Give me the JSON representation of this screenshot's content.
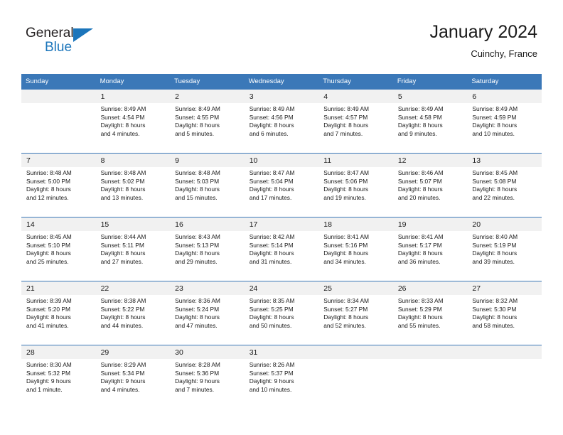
{
  "logo": {
    "word_one": "General",
    "word_two": "Blue",
    "triangle_icon": "triangle-icon",
    "brand_color": "#1b75bb"
  },
  "header": {
    "title": "January 2024",
    "location": "Cuinchy, France"
  },
  "calendar": {
    "header_bg": "#3b78b8",
    "daynum_bg": "#f1f1f1",
    "weekday_headers": [
      "Sunday",
      "Monday",
      "Tuesday",
      "Wednesday",
      "Thursday",
      "Friday",
      "Saturday"
    ],
    "weeks": [
      [
        {
          "day": "",
          "sunrise": "",
          "sunset": "",
          "daylight_line1": "",
          "daylight_line2": ""
        },
        {
          "day": "1",
          "sunrise": "Sunrise: 8:49 AM",
          "sunset": "Sunset: 4:54 PM",
          "daylight_line1": "Daylight: 8 hours",
          "daylight_line2": "and 4 minutes."
        },
        {
          "day": "2",
          "sunrise": "Sunrise: 8:49 AM",
          "sunset": "Sunset: 4:55 PM",
          "daylight_line1": "Daylight: 8 hours",
          "daylight_line2": "and 5 minutes."
        },
        {
          "day": "3",
          "sunrise": "Sunrise: 8:49 AM",
          "sunset": "Sunset: 4:56 PM",
          "daylight_line1": "Daylight: 8 hours",
          "daylight_line2": "and 6 minutes."
        },
        {
          "day": "4",
          "sunrise": "Sunrise: 8:49 AM",
          "sunset": "Sunset: 4:57 PM",
          "daylight_line1": "Daylight: 8 hours",
          "daylight_line2": "and 7 minutes."
        },
        {
          "day": "5",
          "sunrise": "Sunrise: 8:49 AM",
          "sunset": "Sunset: 4:58 PM",
          "daylight_line1": "Daylight: 8 hours",
          "daylight_line2": "and 9 minutes."
        },
        {
          "day": "6",
          "sunrise": "Sunrise: 8:49 AM",
          "sunset": "Sunset: 4:59 PM",
          "daylight_line1": "Daylight: 8 hours",
          "daylight_line2": "and 10 minutes."
        }
      ],
      [
        {
          "day": "7",
          "sunrise": "Sunrise: 8:48 AM",
          "sunset": "Sunset: 5:00 PM",
          "daylight_line1": "Daylight: 8 hours",
          "daylight_line2": "and 12 minutes."
        },
        {
          "day": "8",
          "sunrise": "Sunrise: 8:48 AM",
          "sunset": "Sunset: 5:02 PM",
          "daylight_line1": "Daylight: 8 hours",
          "daylight_line2": "and 13 minutes."
        },
        {
          "day": "9",
          "sunrise": "Sunrise: 8:48 AM",
          "sunset": "Sunset: 5:03 PM",
          "daylight_line1": "Daylight: 8 hours",
          "daylight_line2": "and 15 minutes."
        },
        {
          "day": "10",
          "sunrise": "Sunrise: 8:47 AM",
          "sunset": "Sunset: 5:04 PM",
          "daylight_line1": "Daylight: 8 hours",
          "daylight_line2": "and 17 minutes."
        },
        {
          "day": "11",
          "sunrise": "Sunrise: 8:47 AM",
          "sunset": "Sunset: 5:06 PM",
          "daylight_line1": "Daylight: 8 hours",
          "daylight_line2": "and 19 minutes."
        },
        {
          "day": "12",
          "sunrise": "Sunrise: 8:46 AM",
          "sunset": "Sunset: 5:07 PM",
          "daylight_line1": "Daylight: 8 hours",
          "daylight_line2": "and 20 minutes."
        },
        {
          "day": "13",
          "sunrise": "Sunrise: 8:45 AM",
          "sunset": "Sunset: 5:08 PM",
          "daylight_line1": "Daylight: 8 hours",
          "daylight_line2": "and 22 minutes."
        }
      ],
      [
        {
          "day": "14",
          "sunrise": "Sunrise: 8:45 AM",
          "sunset": "Sunset: 5:10 PM",
          "daylight_line1": "Daylight: 8 hours",
          "daylight_line2": "and 25 minutes."
        },
        {
          "day": "15",
          "sunrise": "Sunrise: 8:44 AM",
          "sunset": "Sunset: 5:11 PM",
          "daylight_line1": "Daylight: 8 hours",
          "daylight_line2": "and 27 minutes."
        },
        {
          "day": "16",
          "sunrise": "Sunrise: 8:43 AM",
          "sunset": "Sunset: 5:13 PM",
          "daylight_line1": "Daylight: 8 hours",
          "daylight_line2": "and 29 minutes."
        },
        {
          "day": "17",
          "sunrise": "Sunrise: 8:42 AM",
          "sunset": "Sunset: 5:14 PM",
          "daylight_line1": "Daylight: 8 hours",
          "daylight_line2": "and 31 minutes."
        },
        {
          "day": "18",
          "sunrise": "Sunrise: 8:41 AM",
          "sunset": "Sunset: 5:16 PM",
          "daylight_line1": "Daylight: 8 hours",
          "daylight_line2": "and 34 minutes."
        },
        {
          "day": "19",
          "sunrise": "Sunrise: 8:41 AM",
          "sunset": "Sunset: 5:17 PM",
          "daylight_line1": "Daylight: 8 hours",
          "daylight_line2": "and 36 minutes."
        },
        {
          "day": "20",
          "sunrise": "Sunrise: 8:40 AM",
          "sunset": "Sunset: 5:19 PM",
          "daylight_line1": "Daylight: 8 hours",
          "daylight_line2": "and 39 minutes."
        }
      ],
      [
        {
          "day": "21",
          "sunrise": "Sunrise: 8:39 AM",
          "sunset": "Sunset: 5:20 PM",
          "daylight_line1": "Daylight: 8 hours",
          "daylight_line2": "and 41 minutes."
        },
        {
          "day": "22",
          "sunrise": "Sunrise: 8:38 AM",
          "sunset": "Sunset: 5:22 PM",
          "daylight_line1": "Daylight: 8 hours",
          "daylight_line2": "and 44 minutes."
        },
        {
          "day": "23",
          "sunrise": "Sunrise: 8:36 AM",
          "sunset": "Sunset: 5:24 PM",
          "daylight_line1": "Daylight: 8 hours",
          "daylight_line2": "and 47 minutes."
        },
        {
          "day": "24",
          "sunrise": "Sunrise: 8:35 AM",
          "sunset": "Sunset: 5:25 PM",
          "daylight_line1": "Daylight: 8 hours",
          "daylight_line2": "and 50 minutes."
        },
        {
          "day": "25",
          "sunrise": "Sunrise: 8:34 AM",
          "sunset": "Sunset: 5:27 PM",
          "daylight_line1": "Daylight: 8 hours",
          "daylight_line2": "and 52 minutes."
        },
        {
          "day": "26",
          "sunrise": "Sunrise: 8:33 AM",
          "sunset": "Sunset: 5:29 PM",
          "daylight_line1": "Daylight: 8 hours",
          "daylight_line2": "and 55 minutes."
        },
        {
          "day": "27",
          "sunrise": "Sunrise: 8:32 AM",
          "sunset": "Sunset: 5:30 PM",
          "daylight_line1": "Daylight: 8 hours",
          "daylight_line2": "and 58 minutes."
        }
      ],
      [
        {
          "day": "28",
          "sunrise": "Sunrise: 8:30 AM",
          "sunset": "Sunset: 5:32 PM",
          "daylight_line1": "Daylight: 9 hours",
          "daylight_line2": "and 1 minute."
        },
        {
          "day": "29",
          "sunrise": "Sunrise: 8:29 AM",
          "sunset": "Sunset: 5:34 PM",
          "daylight_line1": "Daylight: 9 hours",
          "daylight_line2": "and 4 minutes."
        },
        {
          "day": "30",
          "sunrise": "Sunrise: 8:28 AM",
          "sunset": "Sunset: 5:36 PM",
          "daylight_line1": "Daylight: 9 hours",
          "daylight_line2": "and 7 minutes."
        },
        {
          "day": "31",
          "sunrise": "Sunrise: 8:26 AM",
          "sunset": "Sunset: 5:37 PM",
          "daylight_line1": "Daylight: 9 hours",
          "daylight_line2": "and 10 minutes."
        },
        {
          "day": "",
          "sunrise": "",
          "sunset": "",
          "daylight_line1": "",
          "daylight_line2": ""
        },
        {
          "day": "",
          "sunrise": "",
          "sunset": "",
          "daylight_line1": "",
          "daylight_line2": ""
        },
        {
          "day": "",
          "sunrise": "",
          "sunset": "",
          "daylight_line1": "",
          "daylight_line2": ""
        }
      ]
    ]
  }
}
